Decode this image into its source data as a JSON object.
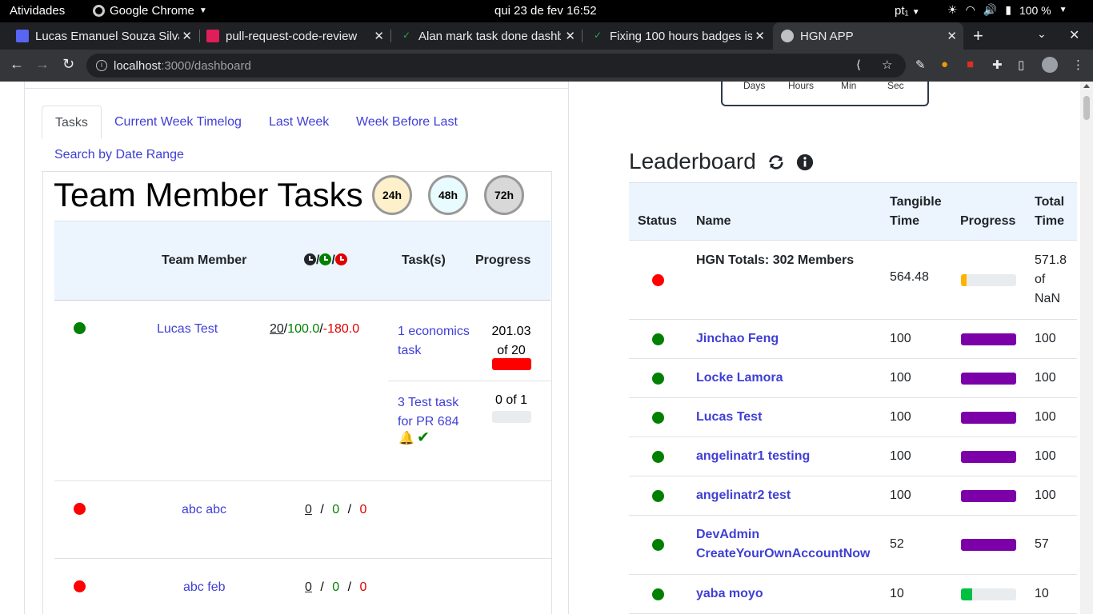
{
  "os_topbar": {
    "activities": "Atividades",
    "app_name": "Google Chrome",
    "clock": "qui 23 de fev  16:52",
    "lang": "pt₁",
    "battery": "100 %"
  },
  "browser": {
    "tabs": [
      {
        "title": "Lucas Emanuel Souza Silva",
        "color": "#5865f2"
      },
      {
        "title": "pull-request-code-review",
        "color": "#e01e5a"
      },
      {
        "title": "Alan mark task done dashb",
        "color": "#2ea44f"
      },
      {
        "title": "Fixing 100 hours badges is",
        "color": "#2ea44f"
      },
      {
        "title": "HGN APP",
        "color": "#bdc1c6"
      }
    ],
    "url_host": "localhost",
    "url_path": ":3000/dashboard"
  },
  "countdown": {
    "days": "Days",
    "hours": "Hours",
    "min": "Min",
    "sec": "Sec"
  },
  "tabs": {
    "tasks": "Tasks",
    "current_week": "Current Week Timelog",
    "last_week": "Last Week",
    "week_before_last": "Week Before Last",
    "date_range": "Search by Date Range"
  },
  "team_tasks": {
    "title": "Team Member Tasks",
    "filters": [
      "24h",
      "48h",
      "72h"
    ],
    "headers": {
      "member": "Team Member",
      "sep": "/",
      "tasks": "Task(s)",
      "progress": "Progress"
    },
    "rows": [
      {
        "name": "Lucas Test",
        "status_color": "#008000",
        "hours_committed": "20",
        "hours_logged": "100.0",
        "hours_remaining": "-180.0",
        "tasks": [
          {
            "line1": "1 economics",
            "line2": "task",
            "progress_line1": "201.03",
            "progress_line2": "of 20",
            "progress_fraction": 1.0,
            "bar_color": "#ff0000"
          },
          {
            "line1": "3 Test task",
            "line2": "for PR 684",
            "progress_line1": "0 of 1",
            "progress_line2": "",
            "progress_fraction": 0.0,
            "bar_color": "#e9ecef"
          }
        ]
      },
      {
        "name": "abc abc",
        "status_color": "#ff0000",
        "hours_committed": "0",
        "hours_logged": "0",
        "hours_remaining": "0"
      },
      {
        "name": "abc feb",
        "status_color": "#ff0000",
        "hours_committed": "0",
        "hours_logged": "0",
        "hours_remaining": "0"
      }
    ]
  },
  "leaderboard": {
    "title": "Leaderboard",
    "headers": {
      "status": "Status",
      "name": "Name",
      "tangible_1": "Tangible",
      "tangible_2": "Time",
      "progress": "Progress",
      "total_1": "Total",
      "total_2": "Time"
    },
    "totals": {
      "name": "HGN Totals: 302 Members",
      "tangible": "564.48",
      "total_1": "571.8",
      "total_2": "of",
      "total_3": "NaN",
      "status_color": "#ff0000",
      "progress_fraction": 0.1,
      "bar_color": "#ffb300"
    },
    "rows": [
      {
        "name": "Jinchao Feng",
        "tangible": "100",
        "total": "100",
        "status_color": "#008000",
        "progress_fraction": 1.0,
        "bar_color": "#7b00a8"
      },
      {
        "name": "Locke Lamora",
        "tangible": "100",
        "total": "100",
        "status_color": "#008000",
        "progress_fraction": 1.0,
        "bar_color": "#7b00a8"
      },
      {
        "name": "Lucas Test",
        "tangible": "100",
        "total": "100",
        "status_color": "#008000",
        "progress_fraction": 1.0,
        "bar_color": "#7b00a8"
      },
      {
        "name": "angelinatr1 testing",
        "tangible": "100",
        "total": "100",
        "status_color": "#008000",
        "progress_fraction": 1.0,
        "bar_color": "#7b00a8"
      },
      {
        "name": "angelinatr2 test",
        "tangible": "100",
        "total": "100",
        "status_color": "#008000",
        "progress_fraction": 1.0,
        "bar_color": "#7b00a8"
      },
      {
        "name_1": "DevAdmin",
        "name_2": "CreateYourOwnAccountNow",
        "tangible": "52",
        "total": "57",
        "status_color": "#008000",
        "progress_fraction": 1.0,
        "bar_color": "#7b00a8"
      },
      {
        "name": "yaba moyo",
        "tangible": "10",
        "total": "10",
        "status_color": "#008000",
        "progress_fraction": 0.2,
        "bar_color": "#00c040"
      }
    ]
  }
}
